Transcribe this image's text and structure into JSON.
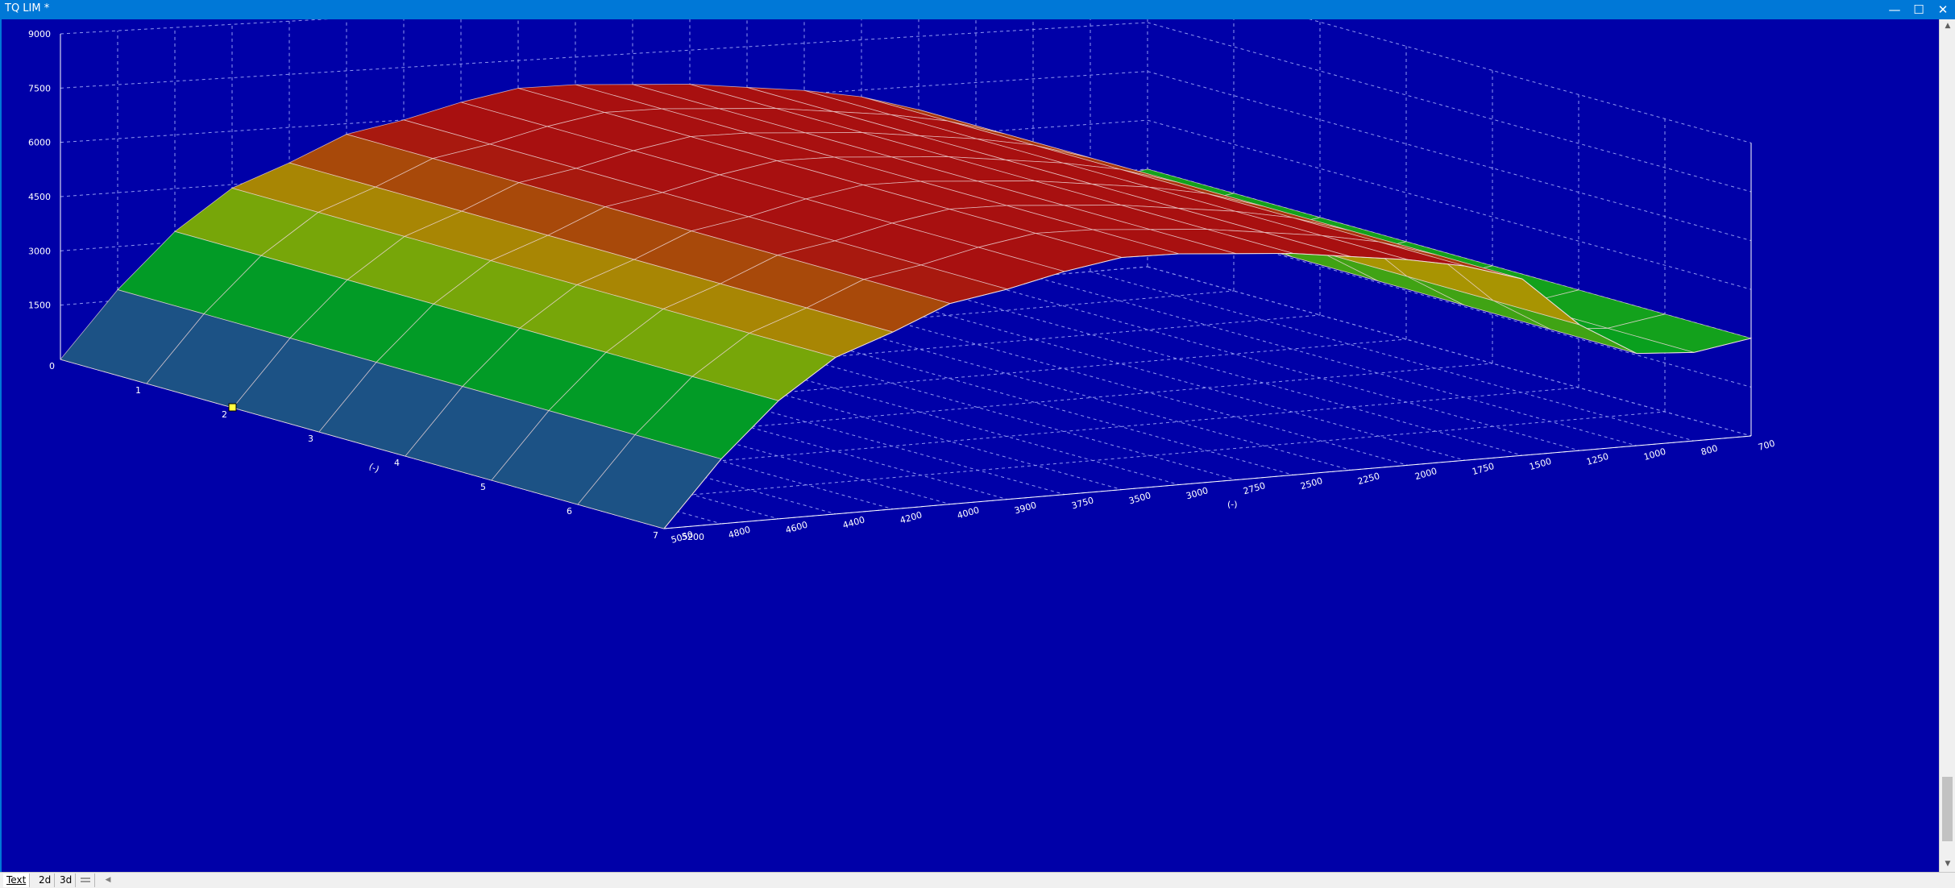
{
  "window": {
    "title": "TQ LIM *",
    "minimize_glyph": "—",
    "maximize_glyph": "☐",
    "close_glyph": "✕"
  },
  "tabs": [
    {
      "label": "Text",
      "active": true
    },
    {
      "label": "2d",
      "active": false
    },
    {
      "label": "3d",
      "active": false
    }
  ],
  "colors": {
    "background": "#0000a8",
    "titlebar": "#0078d7",
    "grid": "#8f97f0",
    "axis": "#ffffff",
    "surface_low": "#2a2ab8",
    "surface_mid": "#00a020",
    "surface_upper": "#a8a800",
    "surface_high": "#a81010",
    "marker": "#ffff40"
  },
  "chart_data": {
    "type": "surface3d",
    "z_ticks": [
      "1500",
      "3000",
      "4500",
      "6000",
      "7500",
      "9000"
    ],
    "z_range": [
      0,
      9000
    ],
    "x_ticks": [
      "0",
      "1",
      "2",
      "3",
      "4",
      "5",
      "6",
      "7"
    ],
    "x_label": "(-)",
    "y_ticks": [
      "5050",
      "4800",
      "4600",
      "4400",
      "4200",
      "4000",
      "3900",
      "3750",
      "3500",
      "3000",
      "2750",
      "2500",
      "2250",
      "2000",
      "1750",
      "1500",
      "1250",
      "1000",
      "800",
      "700"
    ],
    "y_label": "(-)",
    "y_origin_label": "5200",
    "grid": true,
    "surface": [
      [
        0,
        1800,
        3300,
        4400,
        5000,
        5700,
        6000,
        6400,
        6700,
        6700,
        6600,
        6500,
        6300,
        6100,
        5800,
        5300,
        3800,
        2800,
        2700,
        3000
      ],
      [
        0,
        1800,
        3300,
        4400,
        5000,
        5700,
        6000,
        6400,
        6700,
        6700,
        6600,
        6500,
        6300,
        6100,
        5800,
        5300,
        3800,
        2800,
        2700,
        3000
      ],
      [
        0,
        1800,
        3300,
        4400,
        5000,
        5700,
        6000,
        6400,
        6700,
        6700,
        6600,
        6500,
        6300,
        6100,
        5800,
        5300,
        3800,
        2800,
        2700,
        3000
      ],
      [
        0,
        1800,
        3300,
        4400,
        5000,
        5700,
        6000,
        6400,
        6700,
        6700,
        6600,
        6500,
        6300,
        6100,
        5800,
        5300,
        3800,
        2800,
        2700,
        3000
      ],
      [
        0,
        1800,
        3300,
        4400,
        5000,
        5700,
        6000,
        6400,
        6700,
        6700,
        6600,
        6500,
        6300,
        6100,
        5800,
        5300,
        3800,
        2800,
        2700,
        3000
      ],
      [
        0,
        1800,
        3300,
        4400,
        5000,
        5700,
        6000,
        6400,
        6700,
        6700,
        6600,
        6500,
        6300,
        6100,
        5800,
        5300,
        3800,
        2800,
        2700,
        3000
      ],
      [
        0,
        1800,
        3300,
        4400,
        5000,
        5700,
        6000,
        6400,
        6700,
        6700,
        6600,
        6500,
        6300,
        6100,
        5800,
        5300,
        3800,
        2800,
        2700,
        3000
      ],
      [
        0,
        1800,
        3300,
        4400,
        5000,
        5700,
        6000,
        6400,
        6700,
        6700,
        6600,
        6500,
        6300,
        6100,
        5800,
        5300,
        3800,
        2800,
        2700,
        3000
      ]
    ],
    "selected_cell": {
      "x": "2",
      "y": "5050"
    }
  }
}
